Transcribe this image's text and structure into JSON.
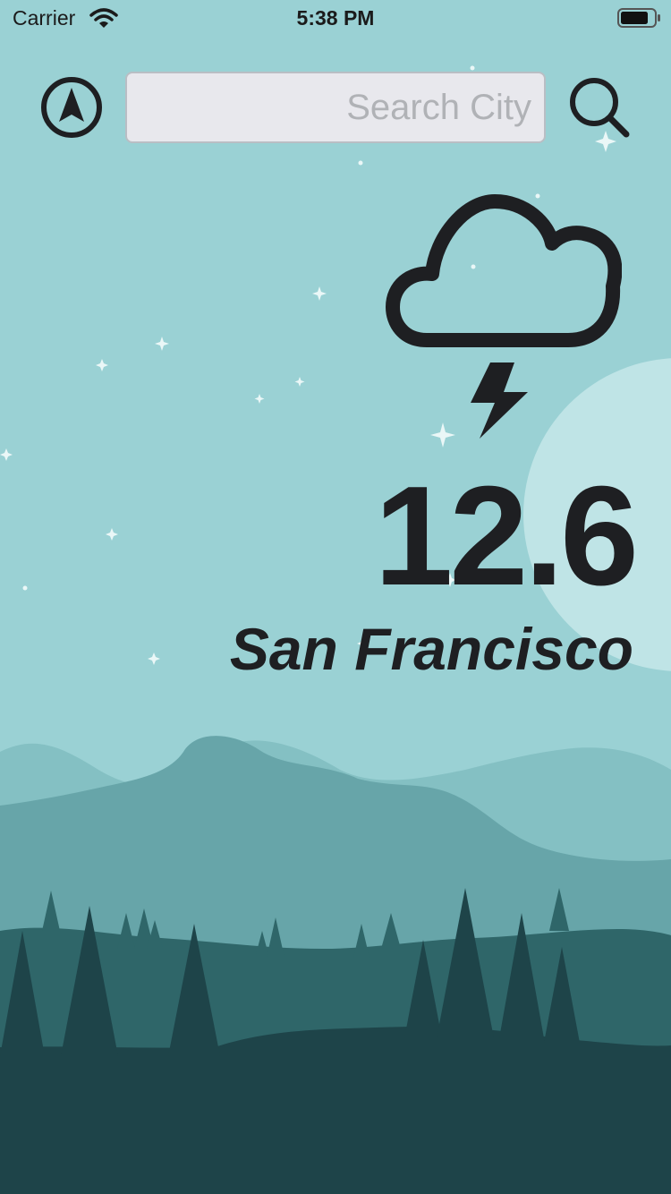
{
  "status_bar": {
    "carrier": "Carrier",
    "time": "5:38 PM"
  },
  "icons": {
    "wifi": "wifi-icon",
    "battery": "battery-icon",
    "location": "location-arrow-icon",
    "search": "magnifier-icon",
    "weather": "cloud-lightning-icon"
  },
  "search": {
    "placeholder": "Search City",
    "value": ""
  },
  "weather": {
    "temperature": "12.6",
    "city": "San Francisco",
    "condition_icon": "thunderstorm"
  },
  "colors": {
    "sky": "#9ad1d4",
    "moon": "#bfe4e6",
    "mountain_far": "#84c0c3",
    "mountain_mid": "#67a5a9",
    "hills": "#2f6669",
    "forest_dark": "#1e4449",
    "text": "#1e1f22"
  }
}
